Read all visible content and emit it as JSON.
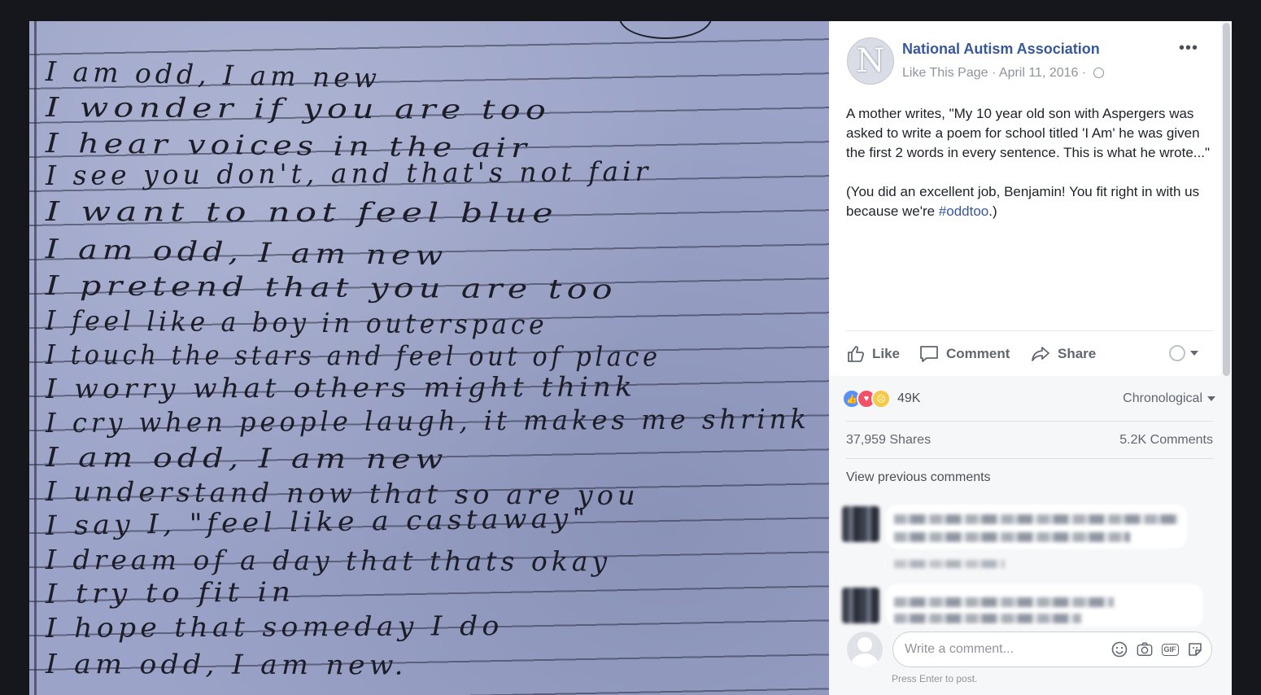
{
  "photo": {
    "poem_lines": [
      "I am odd, I am new",
      "I wonder if you are too",
      "I hear voices in the air",
      "I see you don't, and that's not fair",
      "I want to not feel blue",
      "I am odd, I am new",
      "I pretend that you are too",
      "I feel like a boy in outerspace",
      "I touch the stars and feel out of place",
      "I worry what others might think",
      "I cry when people laugh, it makes me shrink",
      "I am odd, I am new",
      "I understand now that so are you",
      "I say I, \"feel like a castaway\"",
      "I dream of a day that thats okay",
      "I try to fit in",
      "I hope that someday I do",
      "I am odd, I am new."
    ]
  },
  "post": {
    "page_name": "National Autism Association",
    "avatar_letter": "N",
    "like_page": "Like This Page",
    "dot": "·",
    "date": "April 11, 2016",
    "more": "•••",
    "text_p1": "A mother writes, \"My 10 year old son with Aspergers was asked to write a poem for school titled 'I Am' he was given the first 2 words in every sentence. This is what he wrote...\"",
    "text_p2_before": "(You did an excellent job, Benjamin! You fit right in with us because we're ",
    "hashtag": "#oddtoo",
    "text_p2_after": ".)"
  },
  "actions": {
    "like": "Like",
    "comment": "Comment",
    "share": "Share"
  },
  "stats": {
    "reaction_count": "49K",
    "sort": "Chronological",
    "shares": "37,959 Shares",
    "comments": "5.2K Comments",
    "view_previous": "View previous comments"
  },
  "composer": {
    "placeholder": "Write a comment...",
    "hint": "Press Enter to post.",
    "gif": "GIF"
  },
  "colors": {
    "link": "#385898",
    "muted": "#90949c",
    "like_blue": "#5890ff",
    "love_red": "#f25268"
  }
}
